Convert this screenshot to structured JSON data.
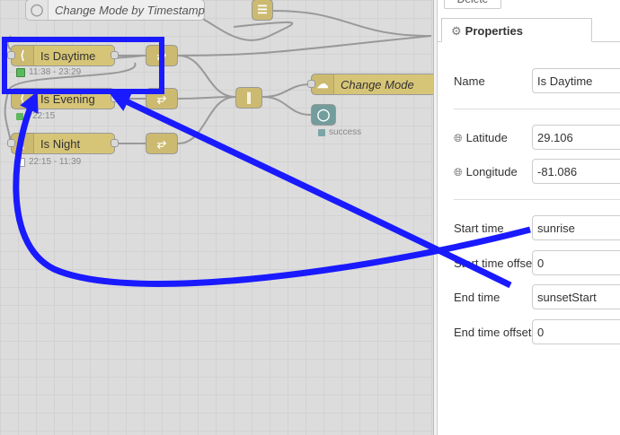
{
  "canvas": {
    "nodes": {
      "change_mode_ts": {
        "label": "Change Mode by Timestamp"
      },
      "is_daytime": {
        "label": "Is Daytime",
        "status": "11:38 - 23:29"
      },
      "is_evening": {
        "label": "Is Evening",
        "status": "- 22:15"
      },
      "is_night": {
        "label": "Is Night",
        "status": "22:15 - 11:39"
      },
      "change_mode": {
        "label": "Change Mode"
      },
      "output": {
        "status": "success"
      }
    }
  },
  "sidebar": {
    "delete_label": "Delete",
    "tab_label": "Properties",
    "name": {
      "label": "Name",
      "value": "Is Daytime"
    },
    "latitude": {
      "label": "Latitude",
      "value": "29.106"
    },
    "longitude": {
      "label": "Longitude",
      "value": "-81.086"
    },
    "start_time": {
      "label": "Start time",
      "value": "sunrise"
    },
    "start_offset": {
      "label": "Start time offset",
      "value": "0"
    },
    "end_time": {
      "label": "End time",
      "value": "sunsetStart"
    },
    "end_offset": {
      "label": "End time offset",
      "value": "0"
    }
  },
  "colors": {
    "annotation": "#1a1aff",
    "node_fill": "#d7c577",
    "status_green": "#5cb85c",
    "status_teal": "#7aa6a6"
  }
}
